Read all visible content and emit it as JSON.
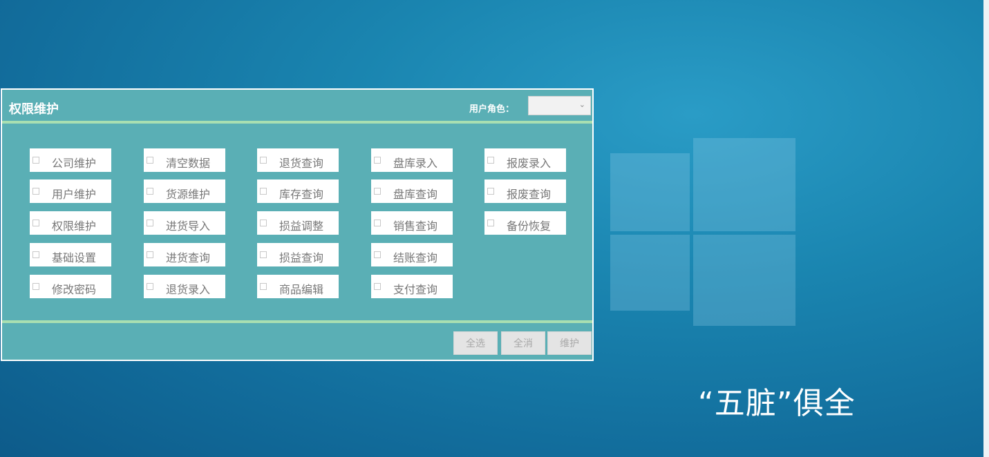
{
  "panel": {
    "title": "权限维护",
    "role_label": "用户角色：",
    "role_value": ""
  },
  "permissions": [
    [
      "公司维护",
      "用户维护",
      "权限维护",
      "基础设置",
      "修改密码"
    ],
    [
      "清空数据",
      "货源维护",
      "进货导入",
      "进货查询",
      "退货录入"
    ],
    [
      "退货查询",
      "库存查询",
      "损益调整",
      "损益查询",
      "商品编辑"
    ],
    [
      "盘库录入",
      "盘库查询",
      "销售查询",
      "结账查询",
      "支付查询"
    ],
    [
      "报废录入",
      "报废查询",
      "备份恢复"
    ]
  ],
  "buttons": {
    "select_all": "全选",
    "clear_all": "全消",
    "save": "维护"
  },
  "slogan": "“五脏”俱全",
  "colors": {
    "panel_bg": "#5aafb5",
    "divider": "#a9dfb1",
    "desktop_bg": "#1a85b0"
  }
}
